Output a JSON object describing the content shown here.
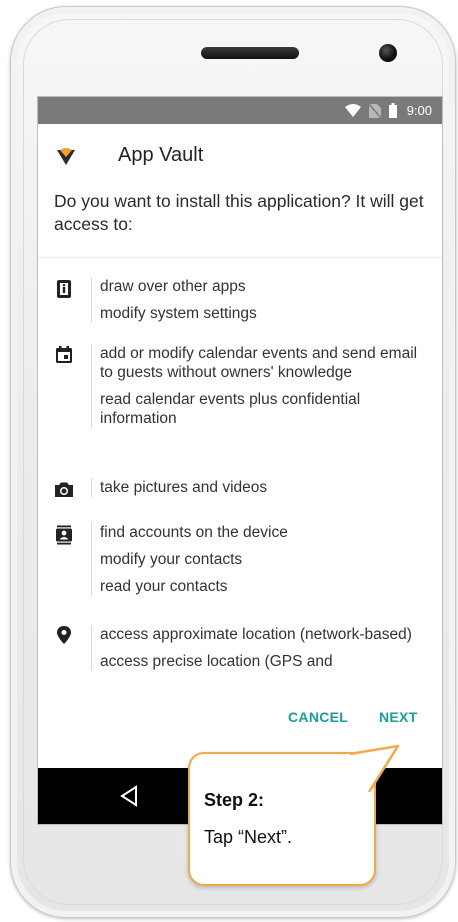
{
  "status_bar": {
    "time": "9:00"
  },
  "app": {
    "name": "App Vault"
  },
  "prompt": {
    "question": "Do you want to install this application? It will get access to:"
  },
  "permissions": [
    {
      "icon": "screen-overlay-icon",
      "items": [
        "draw over other apps",
        "modify system settings"
      ]
    },
    {
      "icon": "calendar-icon",
      "items": [
        "add or modify calendar events and send email to guests without owners' knowledge",
        "read calendar events plus confidential information"
      ]
    },
    {
      "icon": "camera-icon",
      "items": [
        "take pictures and videos"
      ]
    },
    {
      "icon": "contacts-icon",
      "items": [
        "find accounts on the device",
        "modify your contacts",
        "read your contacts"
      ]
    },
    {
      "icon": "location-pin-icon",
      "items": [
        "access approximate location (network-based)",
        "access precise location (GPS and"
      ]
    }
  ],
  "actions": {
    "cancel_label": "CANCEL",
    "next_label": "NEXT"
  },
  "callout": {
    "title": "Step 2:",
    "text": "Tap “Next”."
  },
  "colors": {
    "accent": "#1b9e96",
    "callout_border": "#f2a94a",
    "status_bar": "#7a7a7a",
    "logo_orange": "#f4a12a"
  }
}
